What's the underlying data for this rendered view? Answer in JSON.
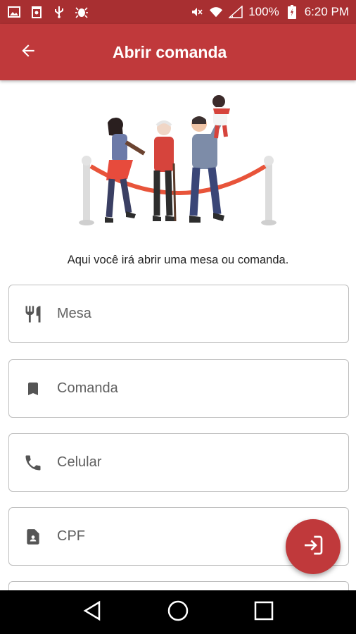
{
  "status_bar": {
    "battery": "100%",
    "time": "6:20 PM",
    "left_icons": [
      "image-icon",
      "recycle-icon",
      "usb-icon",
      "bug-icon"
    ],
    "right_icons": [
      "mute-icon",
      "wifi-icon",
      "signal-icon",
      "battery-icon"
    ]
  },
  "app_bar": {
    "title": "Abrir comanda",
    "back_icon": "arrow-left-icon",
    "color": "#c0393b"
  },
  "main": {
    "subtitle": "Aqui você irá abrir uma mesa ou comanda.",
    "fields": [
      {
        "label": "Mesa",
        "icon": "fork-knife-icon"
      },
      {
        "label": "Comanda",
        "icon": "bookmark-icon"
      },
      {
        "label": "Celular",
        "icon": "phone-icon"
      },
      {
        "label": "CPF",
        "icon": "id-document-icon"
      }
    ]
  },
  "fab": {
    "icon": "login-icon"
  },
  "nav_bar": {
    "icons": [
      "back-triangle-icon",
      "home-circle-icon",
      "recents-square-icon"
    ]
  }
}
